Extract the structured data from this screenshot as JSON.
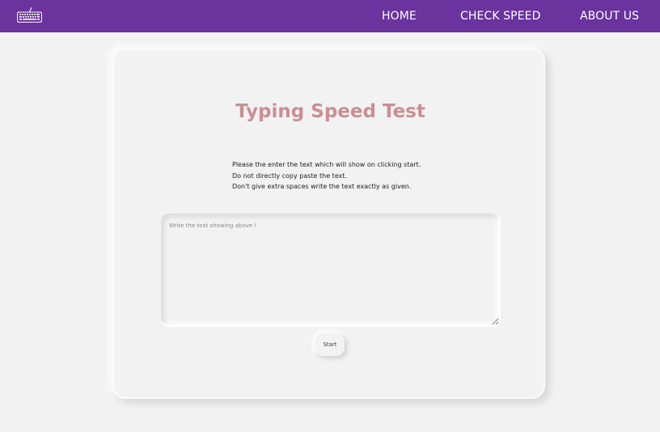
{
  "nav": {
    "logo_icon": "keyboard-icon",
    "links": [
      "HOME",
      "CHECK SPEED",
      "ABOUT US"
    ]
  },
  "main": {
    "title": "Typing Speed Test",
    "instructions": [
      "Please the enter the text which will show on clicking start.",
      "Do not directly copy paste the text.",
      "Don't give extra spaces write the text exactly as given."
    ],
    "input_placeholder": "Write the text showing above !",
    "input_value": "",
    "start_label": "Start"
  },
  "colors": {
    "navbar": "#6a339d",
    "background": "#f2f2f2",
    "title": "#c98f92"
  }
}
